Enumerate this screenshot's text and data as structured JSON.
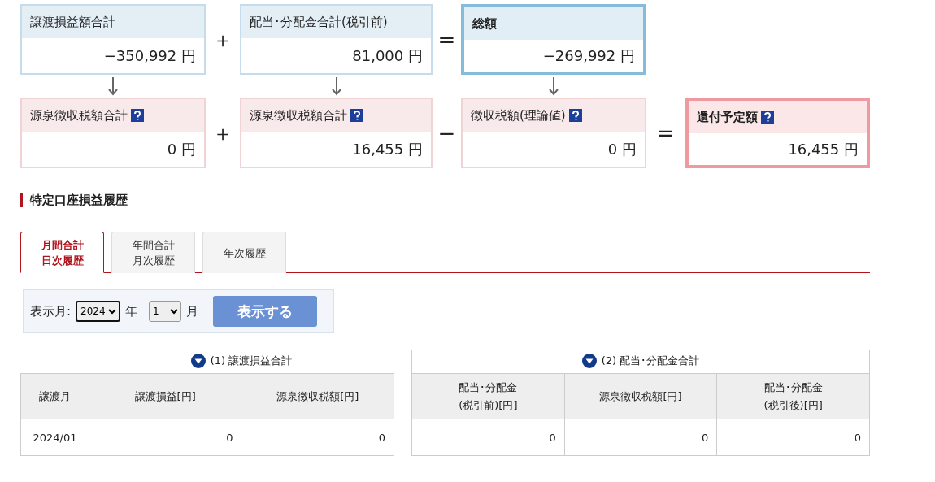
{
  "formula": {
    "rows": [
      {
        "items": [
          {
            "kind": "box",
            "color": "#c6dcea",
            "emphasis": false,
            "help": false,
            "title": "譲渡損益額合計",
            "value": "−350,992 円"
          },
          {
            "kind": "operator",
            "symbol": "＋"
          },
          {
            "kind": "box",
            "color": "#c6dcea",
            "emphasis": false,
            "help": false,
            "title": "配当･分配金合計(税引前)",
            "value": "81,000 円"
          },
          {
            "kind": "operator",
            "symbol": "="
          },
          {
            "kind": "box",
            "color": "#86bcd9",
            "emphasis": true,
            "help": false,
            "title": "総額",
            "value": "−269,992 円"
          }
        ]
      },
      {
        "items": [
          {
            "kind": "box",
            "color": "#f1d2d5",
            "emphasis": false,
            "help": true,
            "title": "源泉徴収税額合計",
            "value": "0 円"
          },
          {
            "kind": "operator",
            "symbol": "＋"
          },
          {
            "kind": "box",
            "color": "#f1d2d5",
            "emphasis": false,
            "help": true,
            "title": "源泉徴収税額合計",
            "value": "16,455 円"
          },
          {
            "kind": "operator",
            "symbol": "−"
          },
          {
            "kind": "box",
            "color": "#f1d2d5",
            "emphasis": false,
            "help": true,
            "title": "徴収税額(理論値)",
            "value": "0 円"
          },
          {
            "kind": "operator",
            "symbol": "="
          },
          {
            "kind": "box",
            "color": "#ef9aa1",
            "emphasis": true,
            "help": true,
            "title": "還付予定額",
            "value": "16,455 円"
          }
        ]
      }
    ]
  },
  "section_title": "特定口座損益履歴",
  "tabs": [
    {
      "lines": [
        "月間合計",
        "日次履歴"
      ],
      "selected": true
    },
    {
      "lines": [
        "年間合計",
        "月次履歴"
      ],
      "selected": false
    },
    {
      "lines": [
        "年次履歴"
      ],
      "selected": false
    }
  ],
  "filter": {
    "label": "表示月:",
    "year": "2024",
    "year_unit": "年",
    "month": "1",
    "month_unit": "月",
    "button": "表示する"
  },
  "tables": [
    {
      "group_title": "(1) 譲渡損益合計",
      "lead_column": "譲渡月",
      "columns": [
        "譲渡損益[円]",
        "源泉徴収税額[円]"
      ],
      "rows": [
        {
          "lead": "2024/01",
          "cells": [
            "0",
            "0"
          ]
        }
      ]
    },
    {
      "group_title": "(2) 配当･分配金合計",
      "columns": [
        "配当･分配金\n(税引前)[円]",
        "源泉徴収税額[円]",
        "配当･分配金\n(税引後)[円]"
      ],
      "rows": [
        {
          "cells": [
            "0",
            "0",
            "0"
          ]
        }
      ]
    }
  ]
}
